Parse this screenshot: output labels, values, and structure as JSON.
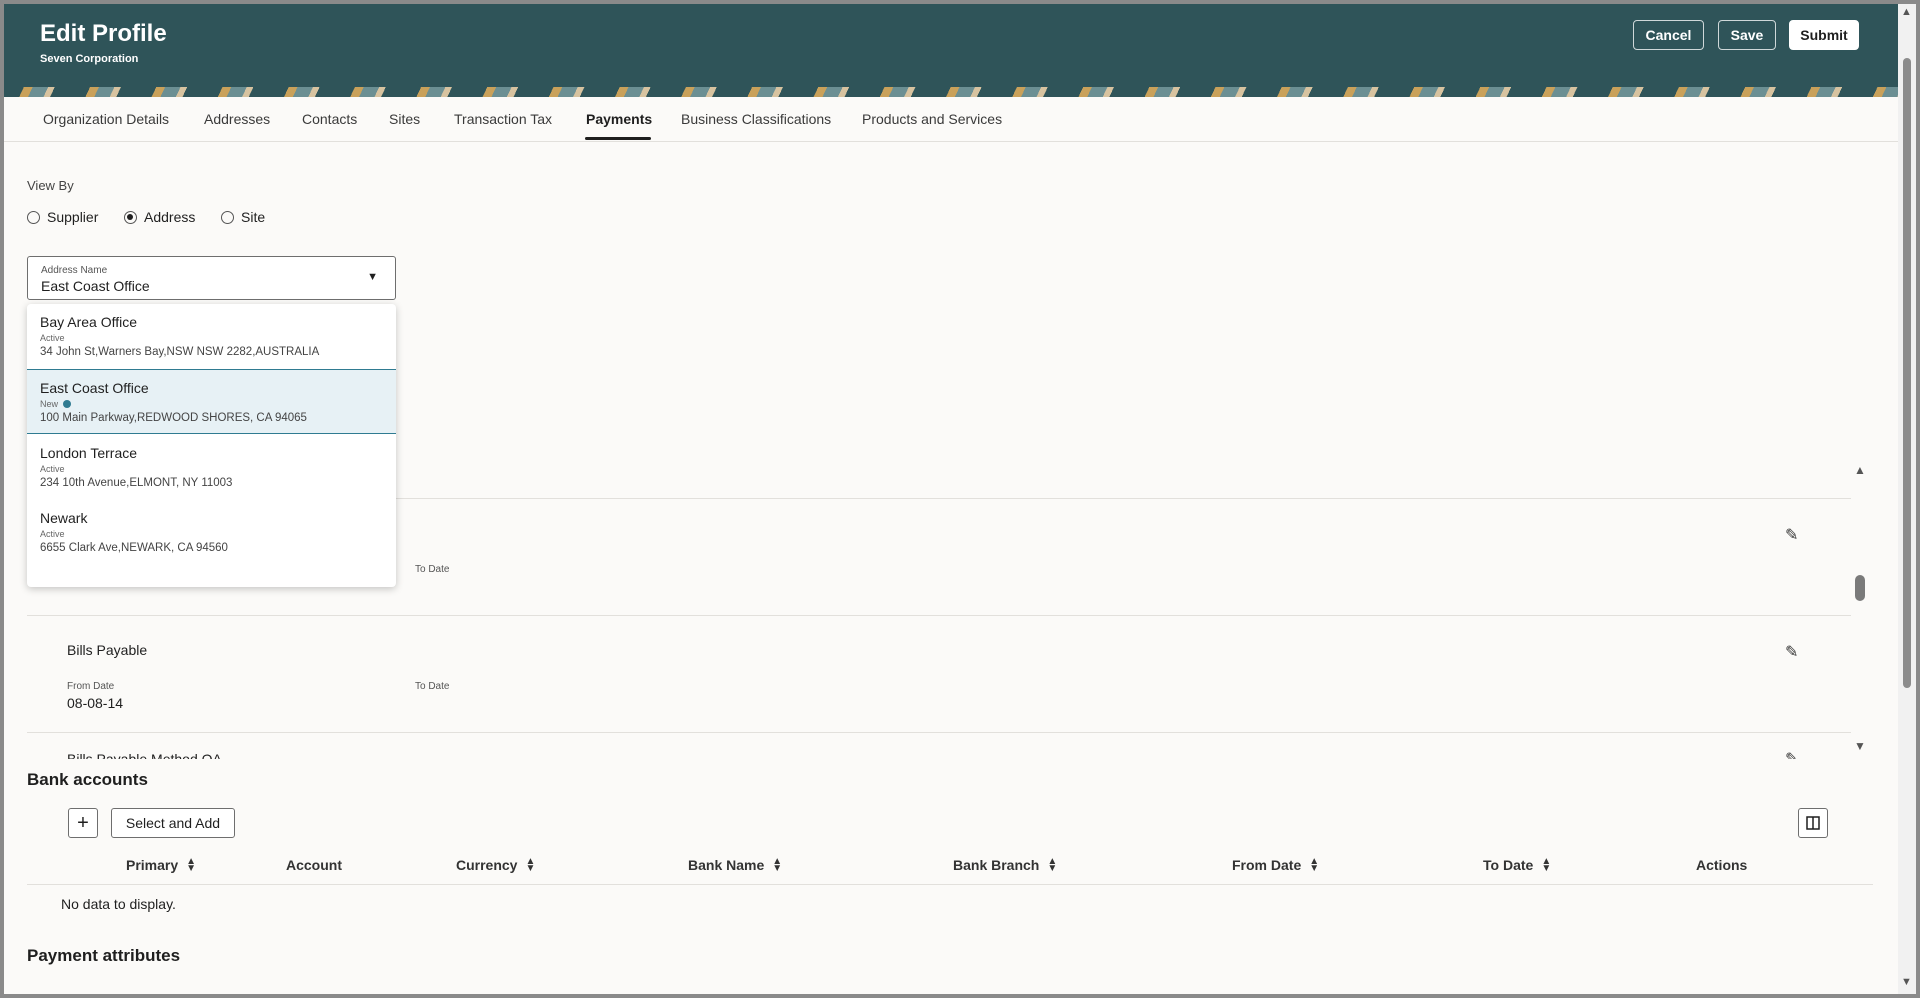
{
  "header": {
    "title": "Edit Profile",
    "subtitle": "Seven Corporation",
    "cancel_label": "Cancel",
    "save_label": "Save",
    "submit_label": "Submit"
  },
  "tabs": [
    {
      "label": "Organization Details"
    },
    {
      "label": "Addresses"
    },
    {
      "label": "Contacts"
    },
    {
      "label": "Sites"
    },
    {
      "label": "Transaction Tax"
    },
    {
      "label": "Payments",
      "active": true
    },
    {
      "label": "Business Classifications"
    },
    {
      "label": "Products and Services"
    }
  ],
  "view_by": {
    "label": "View By",
    "options": [
      {
        "label": "Supplier",
        "checked": false
      },
      {
        "label": "Address",
        "checked": true
      },
      {
        "label": "Site",
        "checked": false
      }
    ]
  },
  "address_select": {
    "label": "Address Name",
    "value": "East Coast Office"
  },
  "dropdown": {
    "items": [
      {
        "name": "Bay Area Office",
        "status": "Active",
        "address": "34 John St,Warners Bay,NSW NSW 2282,AUSTRALIA"
      },
      {
        "name": "East Coast Office",
        "status": "New",
        "address": "100 Main Parkway,REDWOOD SHORES, CA 94065",
        "selected": true
      },
      {
        "name": "London Terrace",
        "status": "Active",
        "address": "234 10th Avenue,ELMONT, NY 11003"
      },
      {
        "name": "Newark",
        "status": "Active",
        "address": "6655 Clark Ave,NEWARK, CA 94560"
      }
    ]
  },
  "payment_methods": [
    {
      "name": "",
      "from_label": "",
      "from_value": "",
      "to_label": "To Date"
    },
    {
      "name": "Bills Payable",
      "from_label": "From Date",
      "from_value": "08-08-14",
      "to_label": "To Date"
    },
    {
      "name": "Bills Payable Method OA",
      "from_label": "",
      "from_value": "",
      "to_label": ""
    }
  ],
  "bank_accounts": {
    "title": "Bank accounts",
    "select_add_label": "Select and Add",
    "columns": [
      "Primary",
      "Account",
      "Currency",
      "Bank Name",
      "Bank Branch",
      "From Date",
      "To Date",
      "Actions"
    ],
    "empty_text": "No data to display."
  },
  "payment_attributes": {
    "title": "Payment attributes"
  },
  "icons": {
    "add": "plus-icon",
    "columns": "columns-icon",
    "edit": "pencil-icon",
    "dropdown": "chevron-down-icon"
  }
}
